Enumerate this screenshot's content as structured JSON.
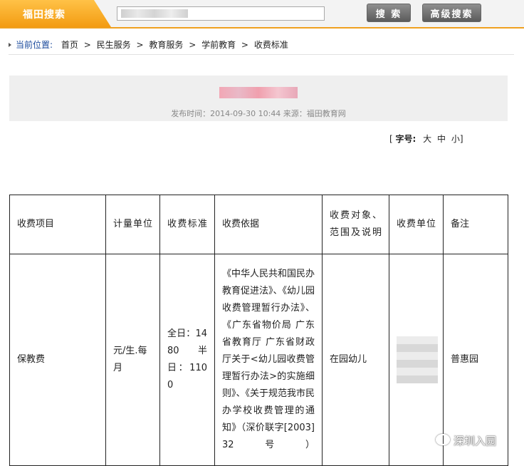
{
  "search_bar": {
    "brand": "福田搜索",
    "input_value": "",
    "search_label": "搜 索",
    "advanced_label": "高级搜索"
  },
  "breadcrumb": {
    "label": "当前位置:",
    "items": [
      "首页",
      "民生服务",
      "教育服务",
      "学前教育",
      "收费标准"
    ],
    "separator": ">"
  },
  "article": {
    "meta": "发布时间：2014-09-30 10:44 来源：福田教育网"
  },
  "font_size": {
    "open": "[",
    "label": "字号:",
    "large": "大",
    "medium": "中",
    "small": "小",
    "close": "]"
  },
  "table": {
    "headers": [
      "收费项目",
      "计量单位",
      "收费标准",
      "收费依据",
      "收费对象、范围及说明",
      "收费单位",
      "备注"
    ],
    "row": {
      "item": "保教费",
      "unit": "元/生.每月",
      "standard": "全日：1480 半日：1100",
      "basis": "《中华人民共和国民办教育促进法》、《幼儿园收费管理暂行办法》、《广东省物价局 广东省教育厅 广东省财政厅关于<幼儿园收费管理暂行办法>的实施细则》、《关于规范我市民办学校收费管理的通知》（深价联字[2003]32号）",
      "scope": "在园幼儿",
      "remark": "普惠园"
    }
  },
  "watermark": "深圳入园"
}
